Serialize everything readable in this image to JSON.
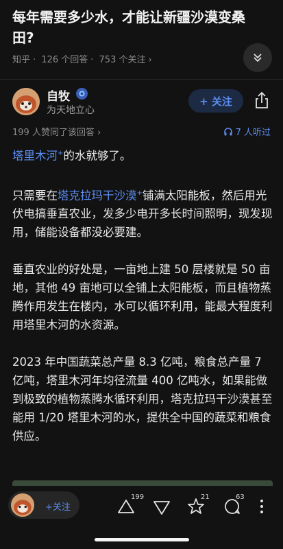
{
  "question": {
    "title": "每年需要多少水，才能让新疆沙漠变桑田?",
    "source": "知乎",
    "answers_count": "126 个回答",
    "followers": "753 个关注"
  },
  "author": {
    "name": "自牧",
    "bio": "为天地立心",
    "follow_label": "+ 关注"
  },
  "stats": {
    "agree_text": "199 人赞同了该回答",
    "listen_text": "7 人听过"
  },
  "content": {
    "p1_link": "塔里木河",
    "p1_rest": "的水就够了。",
    "p2_pre": "只需要在",
    "p2_link": "塔克拉玛干沙漠",
    "p2_rest": "铺满太阳能板，然后用光伏电搞垂直农业，发多少电开多长时间照明，现发现用，储能设备都没必要建。",
    "p3": "垂直农业的好处是，一亩地上建 50 层楼就是 50 亩地，其他 49 亩地可以全铺上太阳能板，而且植物蒸腾作用发生在楼内，水可以循环利用，能最大程度利用塔里木河的水资源。",
    "p4": "2023 年中国蔬菜总产量 8.3 亿吨，粮食总产量 7 亿吨，塔里木河年均径流量 400 亿吨水，如果能做到极致的植物蒸腾水循环利用，塔克拉玛干沙漠甚至能用 1/20 塔里木河的水，提供全中国的蔬菜和粮食供应。"
  },
  "bottom_bar": {
    "follow_label": "+关注",
    "upvotes": "199",
    "favorites": "21",
    "comments": "63"
  }
}
